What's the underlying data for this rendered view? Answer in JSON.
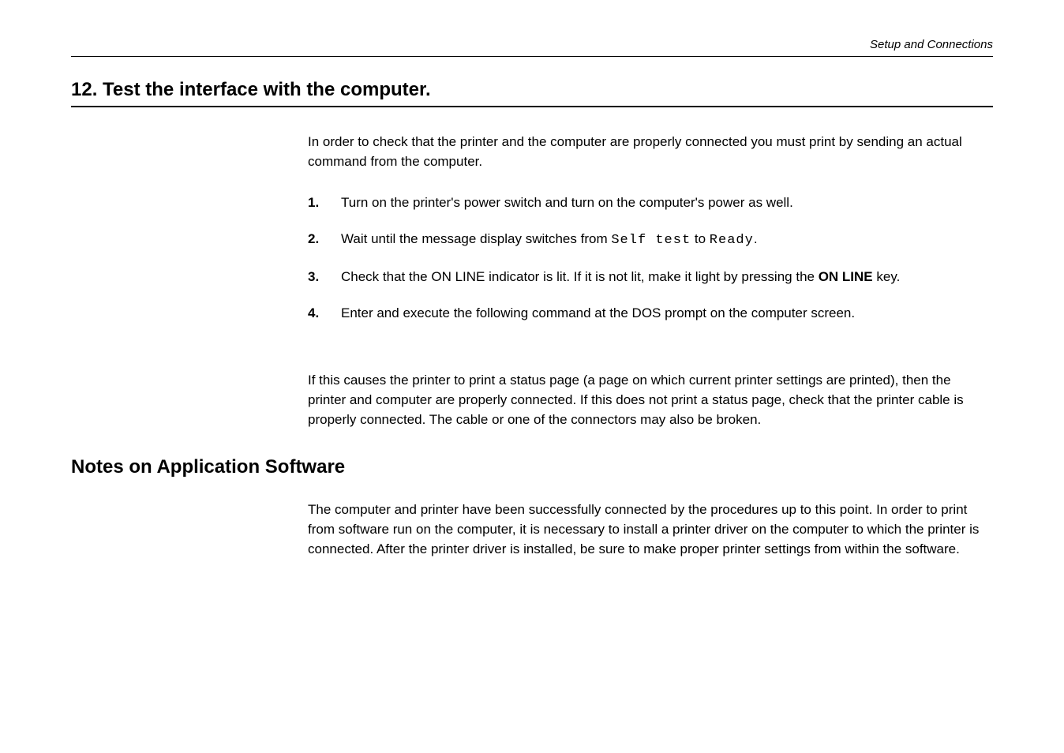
{
  "header": {
    "running_title": "Setup and Connections"
  },
  "section": {
    "number": "12.",
    "title": "Test the interface with the computer."
  },
  "intro": "In order to check that the printer and the computer are properly connected you must print by sending an actual command from the computer.",
  "steps": [
    {
      "num": "1.",
      "text": "Turn on the printer's power switch and turn on the computer's power as well."
    },
    {
      "num": "2.",
      "prefix": "Wait until the message display switches from ",
      "mono1": "Self test",
      "mid": " to ",
      "mono2": "Ready",
      "suffix": "."
    },
    {
      "num": "3.",
      "prefix": "Check that the ON LINE indicator is lit.  If it is not lit, make it light by pressing the ",
      "bold": "ON LINE",
      "suffix": " key."
    },
    {
      "num": "4.",
      "text": "Enter and execute the following command at the DOS prompt on the computer screen."
    }
  ],
  "result": "If this causes the printer to print a status page (a page on which current printer settings are printed),  then the printer and computer are properly connected.  If this does not print a status page, check that  the printer cable is properly connected.  The cable or one of the connectors may also be broken.",
  "subsection": {
    "title": "Notes on Application Software"
  },
  "notes": "The computer and printer have been successfully connected by the procedures up to this point.  In order to print from software run on the computer, it is necessary to install a printer driver on the computer to which the printer is connected. After the printer driver is installed, be sure to make proper printer settings from within the software."
}
